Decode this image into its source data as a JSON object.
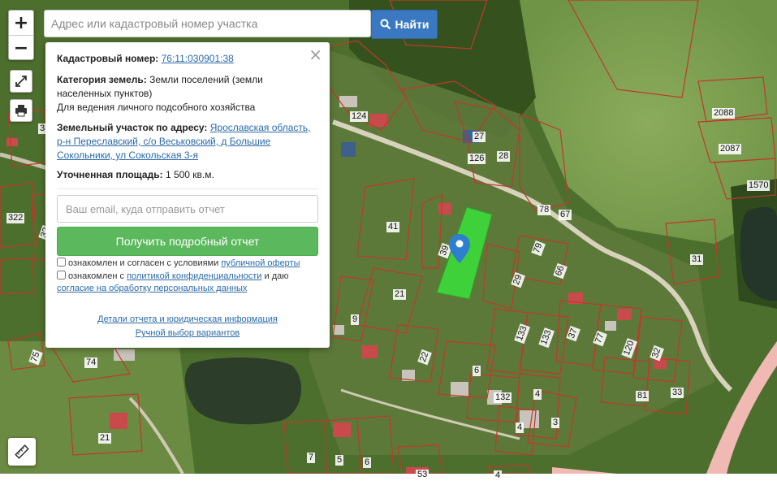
{
  "search": {
    "placeholder": "Адрес или кадастровый номер участка",
    "button_label": "Найти"
  },
  "map_controls": {
    "zoom_in": "+",
    "zoom_out": "−"
  },
  "panel": {
    "close": "×",
    "cadastral_label": "Кадастровый номер:",
    "cadastral_value": "76:11:030901:38",
    "category_label": "Категория земель:",
    "category_value": "Земли поселений (земли населенных пунктов)",
    "category_use": "Для ведения личного подсобного хозяйства",
    "address_label": "Земельный участок по адресу:",
    "address_value": "Ярославская область, р-н Переславский, с/о Веськовский, д Большие Сокольники, ул Сокольская 3-я",
    "area_label": "Уточненная площадь:",
    "area_value": "1 500 кв.м.",
    "email_placeholder": "Ваш email, куда отправить отчет",
    "report_button": "Получить подробный отчет",
    "consent1_text": "ознакомлен и согласен с условиями",
    "consent1_link": "публичной оферты",
    "consent2_text": "ознакомлен с",
    "consent2_link": "политикой конфиденциальности",
    "consent2_mid": "и даю",
    "consent2_link2": "согласие на обработку персональных данных",
    "details_link": "Детали отчета и юридическая информация",
    "manual_link": "Ручной выбор вариантов"
  },
  "map": {
    "parcel_labels": [
      "124",
      "27",
      "126",
      "28",
      "2088",
      "2087",
      "1570",
      "78",
      "67",
      "31",
      "41",
      "39",
      "79",
      "66",
      "29",
      "21",
      "9",
      "133",
      "133",
      "37",
      "77",
      "120",
      "32",
      "81",
      "33",
      "22",
      "6",
      "132",
      "4",
      "4",
      "3",
      "74",
      "75",
      "322",
      "32",
      "33",
      "21",
      "7",
      "5",
      "6",
      "53",
      "4"
    ]
  },
  "colors": {
    "parcel_highlight": "#3fd13a",
    "marker": "#2e7fd0",
    "boundary": "#c0392b",
    "search_button": "#3a79c1",
    "report_button": "#5cb85c"
  }
}
